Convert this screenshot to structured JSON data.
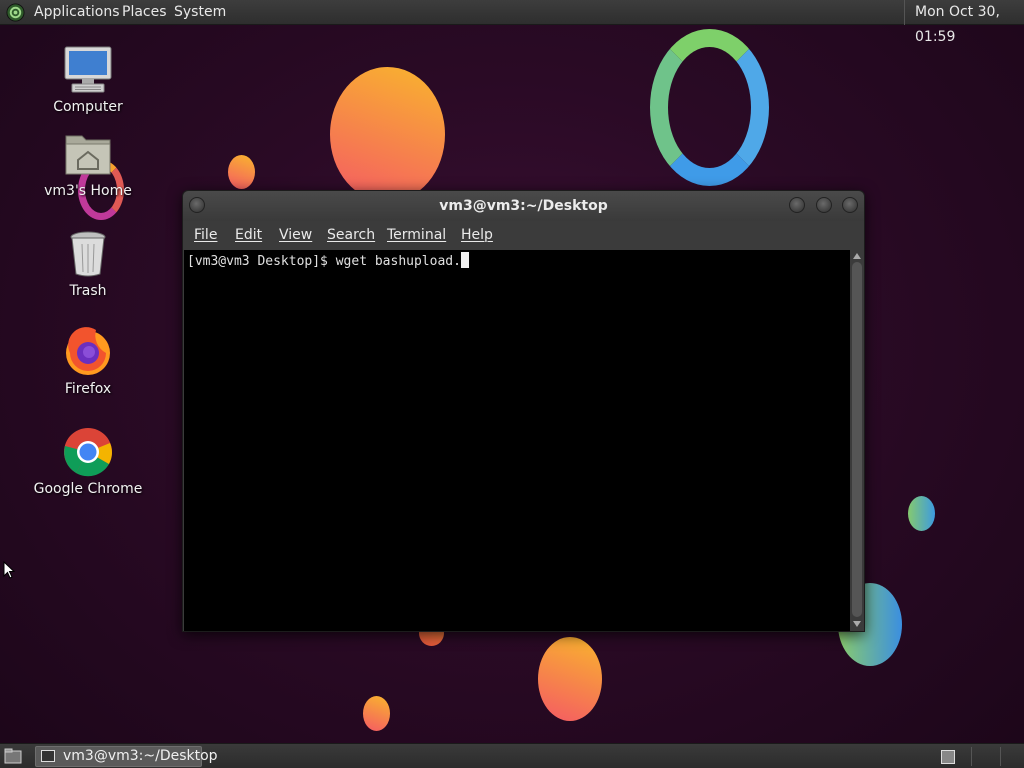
{
  "top_panel": {
    "menu": [
      "Applications",
      "Places",
      "System"
    ],
    "clock": "Mon Oct 30, 01:59"
  },
  "desktop": {
    "icons": [
      {
        "label": "Computer",
        "icon": "computer-icon"
      },
      {
        "label": "vm3's Home",
        "icon": "home-folder-icon"
      },
      {
        "label": "Trash",
        "icon": "trash-icon"
      },
      {
        "label": "Firefox",
        "icon": "firefox-icon"
      },
      {
        "label": "Google Chrome",
        "icon": "chrome-icon"
      }
    ]
  },
  "terminal": {
    "title": "vm3@vm3:~/Desktop",
    "menu": [
      "File",
      "Edit",
      "View",
      "Search",
      "Terminal",
      "Help"
    ],
    "prompt": "[vm3@vm3 Desktop]$ ",
    "command": "wget bashupload."
  },
  "taskbar": {
    "task_label": "vm3@vm3:~/Desktop"
  },
  "colors": {
    "wallpaper": "#2a0a25",
    "panel": "#333333",
    "terminal_bg": "#000000",
    "terminal_fg": "#e0e0e0"
  }
}
